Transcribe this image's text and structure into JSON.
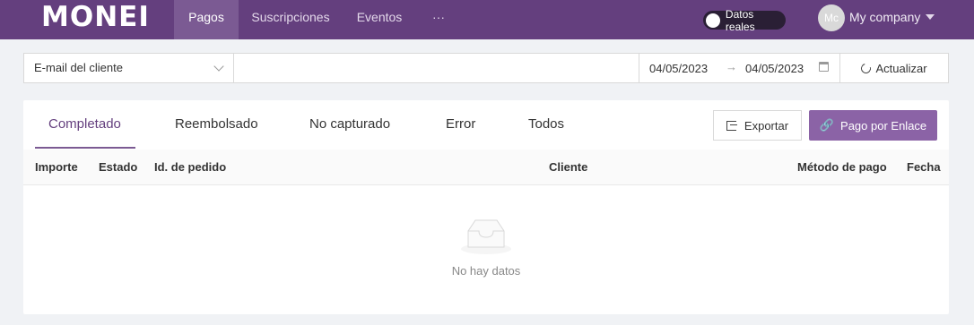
{
  "app": {
    "logo": "MONEI"
  },
  "nav": {
    "items": [
      {
        "label": "Pagos"
      },
      {
        "label": "Suscripciones"
      },
      {
        "label": "Eventos"
      },
      {
        "label": "···"
      }
    ],
    "active": "Pagos"
  },
  "header": {
    "toggle_label": "Datos reales",
    "toggle_on": true,
    "avatar_initials": "Mc",
    "account_name": "My company"
  },
  "filters": {
    "field_select": "E-mail del cliente",
    "search_value": "",
    "date_from": "04/05/2023",
    "date_arrow": "→",
    "date_to": "04/05/2023",
    "refresh_label": "Actualizar"
  },
  "tabs": {
    "items": [
      {
        "label": "Completado"
      },
      {
        "label": "Reembolsado"
      },
      {
        "label": "No capturado"
      },
      {
        "label": "Error"
      },
      {
        "label": "Todos"
      }
    ],
    "active": "Completado"
  },
  "actions": {
    "export_label": "Exportar",
    "paylink_label": "Pago por Enlace"
  },
  "table": {
    "columns": [
      "Importe",
      "Estado",
      "Id. de pedido",
      "Cliente",
      "Método de pago",
      "Fecha"
    ],
    "rows": [],
    "empty_text": "No hay datos"
  },
  "colors": {
    "brand": "#643f7e",
    "primary_button": "#8b63a6"
  }
}
